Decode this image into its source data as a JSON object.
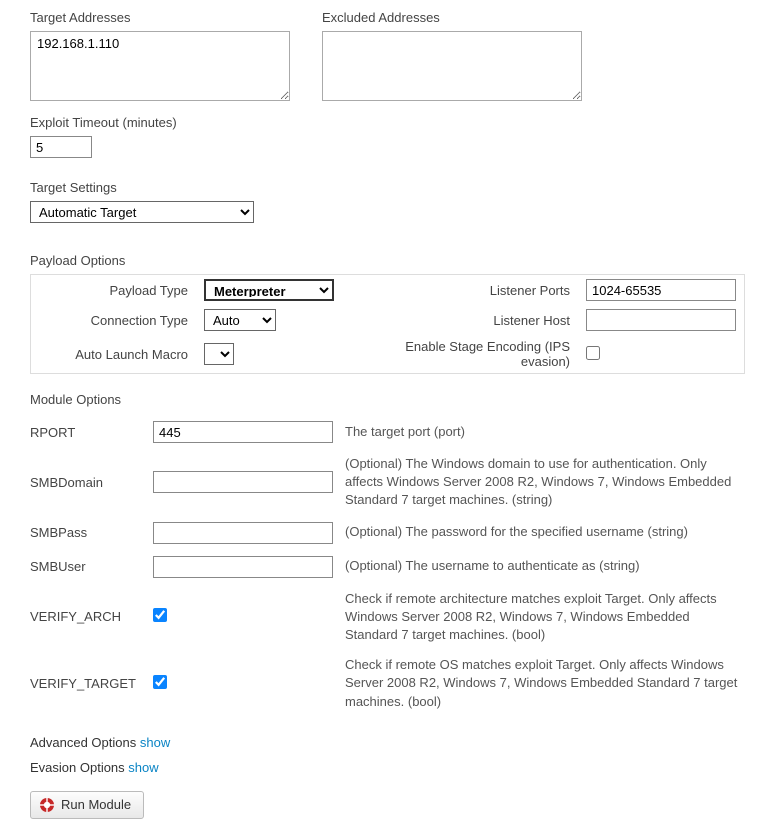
{
  "targetAddresses": {
    "label": "Target Addresses",
    "value": "192.168.1.110"
  },
  "excludedAddresses": {
    "label": "Excluded Addresses",
    "value": ""
  },
  "exploitTimeout": {
    "label": "Exploit Timeout (minutes)",
    "value": "5"
  },
  "targetSettings": {
    "label": "Target Settings",
    "selected": "Automatic Target"
  },
  "payloadOptions": {
    "heading": "Payload Options",
    "payloadType": {
      "label": "Payload Type",
      "selected": "Meterpreter"
    },
    "connectionType": {
      "label": "Connection Type",
      "selected": "Auto"
    },
    "autoLaunchMacro": {
      "label": "Auto Launch Macro",
      "selected": ""
    },
    "listenerPorts": {
      "label": "Listener Ports",
      "value": "1024-65535"
    },
    "listenerHost": {
      "label": "Listener Host",
      "value": ""
    },
    "enableStageEncoding": {
      "label": "Enable Stage Encoding (IPS evasion)",
      "checked": false
    }
  },
  "moduleOptions": {
    "heading": "Module Options",
    "rport": {
      "label": "RPORT",
      "value": "445",
      "desc": "The target port (port)"
    },
    "smbdomain": {
      "label": "SMBDomain",
      "value": "",
      "desc": "(Optional) The Windows domain to use for authentication. Only affects Windows Server 2008 R2, Windows 7, Windows Embedded Standard 7 target machines. (string)"
    },
    "smbpass": {
      "label": "SMBPass",
      "value": "",
      "desc": "(Optional) The password for the specified username (string)"
    },
    "smbuser": {
      "label": "SMBUser",
      "value": "",
      "desc": "(Optional) The username to authenticate as (string)"
    },
    "verifyArch": {
      "label": "VERIFY_ARCH",
      "checked": true,
      "desc": "Check if remote architecture matches exploit Target. Only affects Windows Server 2008 R2, Windows 7, Windows Embedded Standard 7 target machines. (bool)"
    },
    "verifyTarget": {
      "label": "VERIFY_TARGET",
      "checked": true,
      "desc": "Check if remote OS matches exploit Target. Only affects Windows Server 2008 R2, Windows 7, Windows Embedded Standard 7 target machines. (bool)"
    }
  },
  "advancedOptions": {
    "label": "Advanced Options",
    "linkText": "show"
  },
  "evasionOptions": {
    "label": "Evasion Options",
    "linkText": "show"
  },
  "runButton": {
    "label": "Run Module"
  }
}
